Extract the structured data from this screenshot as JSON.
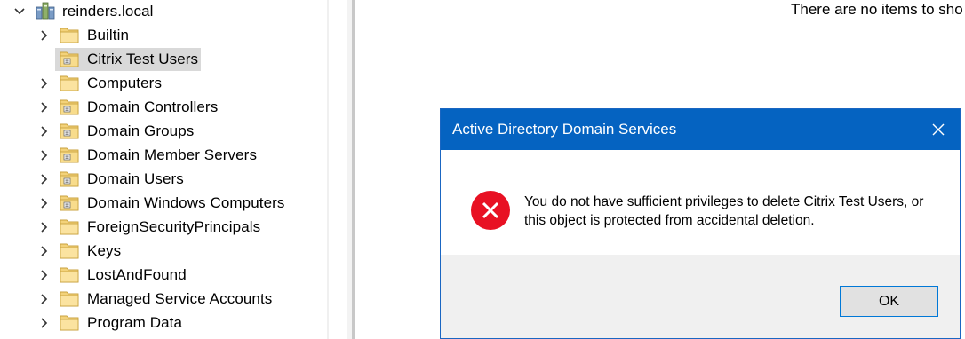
{
  "tree": {
    "root": {
      "label": "reinders.local",
      "icon": "domain-tree-icon",
      "expanded": true
    },
    "items": [
      {
        "label": "Builtin",
        "icon": "folder-icon",
        "has_children": true
      },
      {
        "label": "Citrix Test Users",
        "icon": "ou-folder-icon",
        "has_children": false,
        "selected": true
      },
      {
        "label": "Computers",
        "icon": "folder-icon",
        "has_children": true
      },
      {
        "label": "Domain Controllers",
        "icon": "ou-folder-icon",
        "has_children": true
      },
      {
        "label": "Domain Groups",
        "icon": "ou-folder-icon",
        "has_children": true
      },
      {
        "label": "Domain Member Servers",
        "icon": "ou-folder-icon",
        "has_children": true
      },
      {
        "label": "Domain Users",
        "icon": "ou-folder-icon",
        "has_children": true
      },
      {
        "label": "Domain Windows Computers",
        "icon": "ou-folder-icon",
        "has_children": true
      },
      {
        "label": "ForeignSecurityPrincipals",
        "icon": "folder-icon",
        "has_children": true
      },
      {
        "label": "Keys",
        "icon": "folder-icon",
        "has_children": true
      },
      {
        "label": "LostAndFound",
        "icon": "folder-icon",
        "has_children": true
      },
      {
        "label": "Managed Service Accounts",
        "icon": "folder-icon",
        "has_children": true
      },
      {
        "label": "Program Data",
        "icon": "folder-icon",
        "has_children": true
      }
    ]
  },
  "details_pane": {
    "empty_message": "There are no items to sho"
  },
  "dialog": {
    "title": "Active Directory Domain Services",
    "close_icon": "close-icon",
    "status_icon": "error-icon",
    "message_line1": "You do not have sufficient privileges to delete Citrix Test Users, or",
    "message_line2": "this object is protected from accidental deletion.",
    "ok_label": "OK"
  },
  "colors": {
    "titlebar": "#0563c1",
    "selection": "#d9d9d9",
    "error_red": "#e81123",
    "focus_border": "#0078d7"
  }
}
